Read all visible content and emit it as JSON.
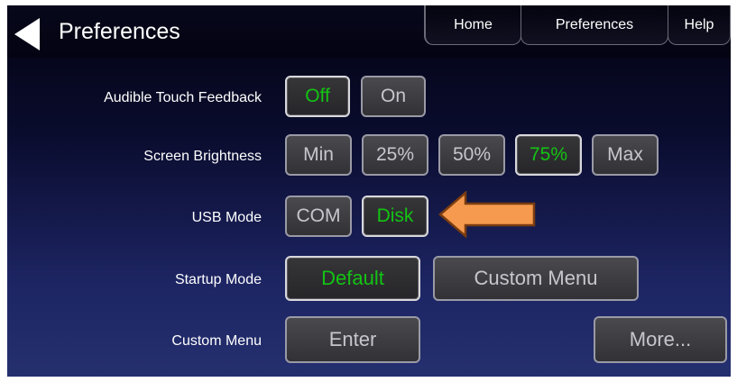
{
  "header": {
    "title": "Preferences",
    "back_icon": "back-arrow-icon",
    "tabs": [
      {
        "label": "Home"
      },
      {
        "label": "Preferences"
      },
      {
        "label": "Help"
      }
    ]
  },
  "rows": {
    "audible": {
      "label": "Audible Touch Feedback",
      "options": [
        "Off",
        "On"
      ],
      "selected": "Off"
    },
    "brightness": {
      "label": "Screen Brightness",
      "options": [
        "Min",
        "25%",
        "50%",
        "75%",
        "Max"
      ],
      "selected": "75%"
    },
    "usb": {
      "label": "USB Mode",
      "options": [
        "COM",
        "Disk"
      ],
      "selected": "Disk"
    },
    "startup": {
      "label": "Startup Mode",
      "options": [
        "Default",
        "Custom Menu"
      ],
      "selected": "Default"
    },
    "custom": {
      "label": "Custom Menu",
      "enter_label": "Enter",
      "more_label": "More..."
    }
  },
  "annotation": {
    "icon": "arrow-left-icon",
    "color": "#f59a4e"
  },
  "colors": {
    "selected_text": "#13c413",
    "button_text": "#c6c6cc",
    "background_top": "#030311",
    "background_bottom": "#25306f"
  }
}
